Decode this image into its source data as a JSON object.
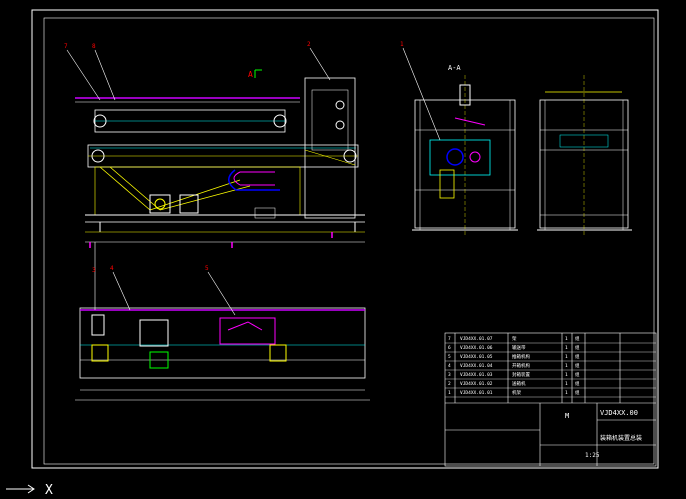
{
  "drawing": {
    "section_label": "A-A",
    "view_marker": "A",
    "part_no": "VJD4XX.00",
    "title": "装箱机装置总装",
    "scale": "1:25",
    "center_mark": "M",
    "leaders": [
      "7",
      "8",
      "2",
      "1",
      "3",
      "4",
      "5"
    ]
  },
  "bom": [
    {
      "no": "7",
      "code": "VJD4XX.01.07",
      "name": "架",
      "qty": "1",
      "mat": "组"
    },
    {
      "no": "6",
      "code": "VJD4XX.01.06",
      "name": "输送带",
      "qty": "1",
      "mat": "组"
    },
    {
      "no": "5",
      "code": "VJD4XX.01.05",
      "name": "推箱机构",
      "qty": "1",
      "mat": "组"
    },
    {
      "no": "4",
      "code": "VJD4XX.01.04",
      "name": "开箱机构",
      "qty": "1",
      "mat": "组"
    },
    {
      "no": "3",
      "code": "VJD4XX.01.03",
      "name": "封箱装置",
      "qty": "1",
      "mat": "组"
    },
    {
      "no": "2",
      "code": "VJD4XX.01.02",
      "name": "送箱机",
      "qty": "1",
      "mat": "组"
    },
    {
      "no": "1",
      "code": "VJD4XX.01.01",
      "name": "机架",
      "qty": "1",
      "mat": "组"
    }
  ],
  "status": {
    "cursor_label": "X"
  }
}
